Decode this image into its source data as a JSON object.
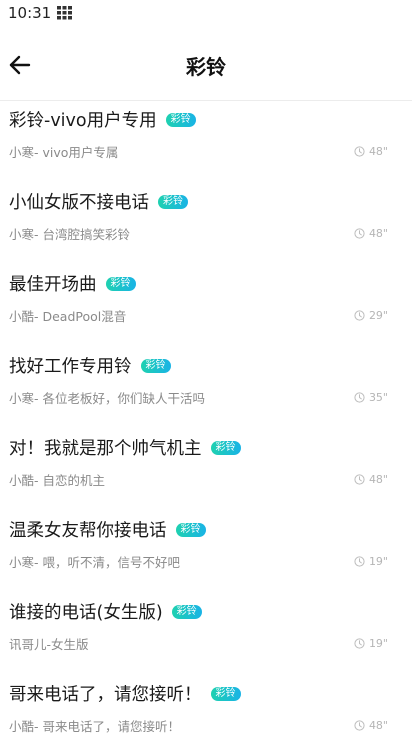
{
  "status_bar": {
    "time": "10:31",
    "icon": "grid-apps-icon"
  },
  "header": {
    "title": "彩铃",
    "back_icon": "arrow-left-icon"
  },
  "badge_label": "彩铃",
  "colors": {
    "badge_start": "#1fd1b0",
    "badge_end": "#19b3e6",
    "subtitle": "#8a8a8a",
    "duration": "#b5b5b5"
  },
  "items": [
    {
      "title": "彩铃-vivo用户专用",
      "subtitle": "小寒- vivo用户专属",
      "duration": "48\""
    },
    {
      "title": "小仙女版不接电话",
      "subtitle": "小寒- 台湾腔搞笑彩铃",
      "duration": "48\""
    },
    {
      "title": "最佳开场曲",
      "subtitle": "小酷- DeadPool混音",
      "duration": "29\""
    },
    {
      "title": "找好工作专用铃",
      "subtitle": "小寒- 各位老板好，你们缺人干活吗",
      "duration": "35\""
    },
    {
      "title": "对！我就是那个帅气机主",
      "subtitle": "小酷- 自恋的机主",
      "duration": "48\""
    },
    {
      "title": "温柔女友帮你接电话",
      "subtitle": "小寒- 喂，听不清，信号不好吧",
      "duration": "19\""
    },
    {
      "title": "谁接的电话(女生版)",
      "subtitle": "讯哥儿-女生版",
      "duration": "19\""
    },
    {
      "title": "哥来电话了，请您接听！",
      "subtitle": "小酷- 哥来电话了，请您接听！",
      "duration": "48\""
    }
  ]
}
